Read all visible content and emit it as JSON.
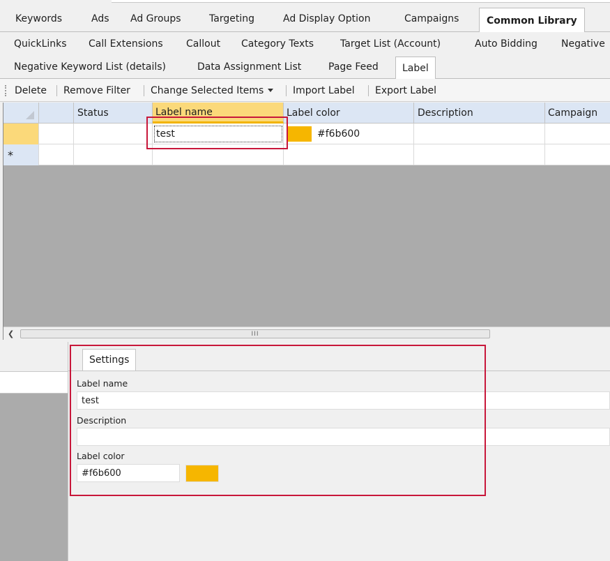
{
  "tabs_row1": [
    {
      "label": "Keywords"
    },
    {
      "label": "Ads"
    },
    {
      "label": "Ad Groups"
    },
    {
      "label": "Targeting"
    },
    {
      "label": "Ad Display Option"
    },
    {
      "label": "Campaigns"
    },
    {
      "label": "Common Library",
      "active": true
    }
  ],
  "tabs_row2": [
    {
      "label": "QuickLinks"
    },
    {
      "label": "Call Extensions"
    },
    {
      "label": "Callout"
    },
    {
      "label": "Category Texts"
    },
    {
      "label": "Target List (Account)"
    },
    {
      "label": "Auto Bidding"
    },
    {
      "label": "Negative"
    }
  ],
  "tabs_row3": [
    {
      "label": "Negative Keyword List (details)"
    },
    {
      "label": "Data Assignment List"
    },
    {
      "label": "Page Feed"
    },
    {
      "label": "Label",
      "active": true
    }
  ],
  "toolbar": {
    "delete": "Delete",
    "remove_filter": "Remove Filter",
    "change_selected": "Change Selected Items",
    "import_label": "Import Label",
    "export_label": "Export Label"
  },
  "grid": {
    "columns": [
      "Status",
      "Label name",
      "Label color",
      "Description",
      "Campaign"
    ],
    "rows": [
      {
        "status": "",
        "label_name": "test",
        "label_color": "#f6b600",
        "label_color_text": "#f6b600",
        "description": "",
        "campaign": ""
      }
    ],
    "new_row_marker": "*",
    "scroll_grip": "III"
  },
  "settings": {
    "tab_label": "Settings",
    "label_name_caption": "Label name",
    "label_name_value": "test",
    "description_caption": "Description",
    "description_value": "",
    "label_color_caption": "Label color",
    "label_color_value": "#f6b600",
    "swatch_color": "#f6b600"
  },
  "colors": {
    "accent": "#f6b600",
    "highlight_box": "#c8173a",
    "header_blue": "#dce6f4",
    "selected_header": "#fbd97a"
  },
  "icons": {
    "scroll_left": "chevron-left-icon",
    "dropdown": "caret-down-icon",
    "corner": "select-all-triangle-icon"
  }
}
